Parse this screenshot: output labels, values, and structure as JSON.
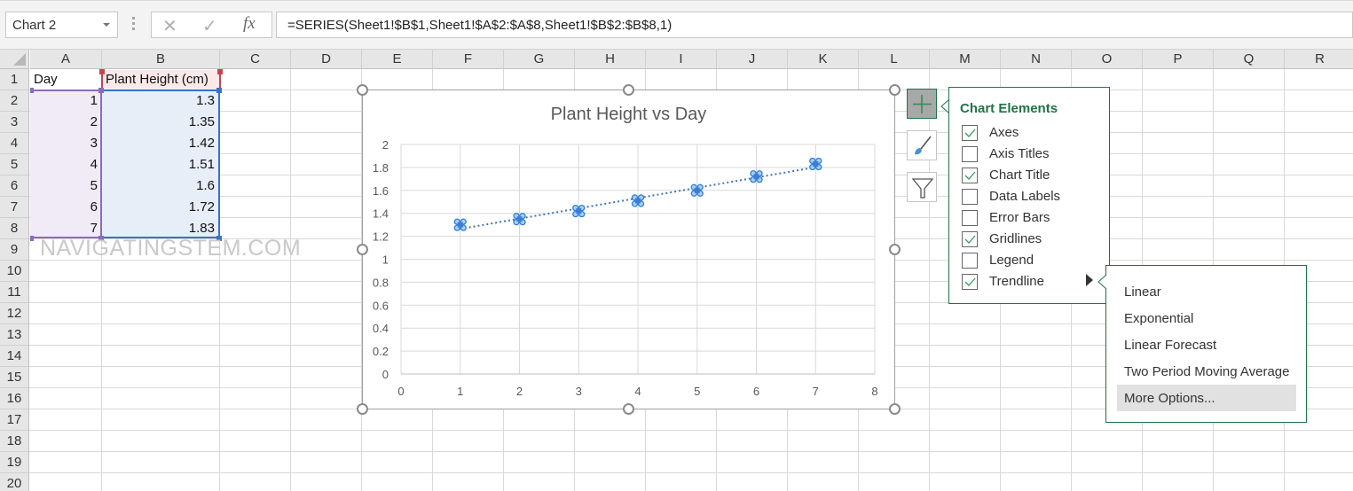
{
  "formula_bar": {
    "name_box": "Chart 2",
    "cancel_icon": "x-icon",
    "enter_icon": "check-icon",
    "fx_label": "fx",
    "formula": "=SERIES(Sheet1!$B$1,Sheet1!$A$2:$A$8,Sheet1!$B$2:$B$8,1)"
  },
  "columns": [
    "A",
    "B",
    "C",
    "D",
    "E",
    "F",
    "G",
    "H",
    "I",
    "J",
    "K",
    "L",
    "M",
    "N",
    "O",
    "P",
    "Q",
    "R"
  ],
  "rows": [
    "1",
    "2",
    "3",
    "4",
    "5",
    "6",
    "7",
    "8",
    "9",
    "10",
    "11",
    "12",
    "13",
    "14",
    "15",
    "16",
    "17",
    "18",
    "19",
    "20"
  ],
  "sheet": {
    "header": {
      "A": "Day",
      "B": "Plant Height (cm)"
    },
    "data": [
      {
        "A": "1",
        "B": "1.3"
      },
      {
        "A": "2",
        "B": "1.35"
      },
      {
        "A": "3",
        "B": "1.42"
      },
      {
        "A": "4",
        "B": "1.51"
      },
      {
        "A": "5",
        "B": "1.6"
      },
      {
        "A": "6",
        "B": "1.72"
      },
      {
        "A": "7",
        "B": "1.83"
      }
    ]
  },
  "watermark": "NAVIGATINGSTEM.COM",
  "chart_data": {
    "type": "scatter",
    "title": "Plant Height vs Day",
    "xlabel": "",
    "ylabel": "",
    "x": [
      1,
      2,
      3,
      4,
      5,
      6,
      7
    ],
    "series": [
      {
        "name": "Plant Height (cm)",
        "values": [
          1.3,
          1.35,
          1.42,
          1.51,
          1.6,
          1.72,
          1.83
        ]
      }
    ],
    "xlim": [
      0,
      8
    ],
    "ylim": [
      0,
      2
    ],
    "x_ticks": [
      "0",
      "1",
      "2",
      "3",
      "4",
      "5",
      "6",
      "7",
      "8"
    ],
    "y_ticks": [
      "0",
      "0.2",
      "0.4",
      "0.6",
      "0.8",
      "1",
      "1.2",
      "1.4",
      "1.6",
      "1.8",
      "2"
    ],
    "grid": true,
    "legend": "none",
    "trendline": "linear",
    "colors": {
      "marker": "#4a90d9",
      "trendline": "#4472c4",
      "grid": "#d9d9d9"
    }
  },
  "chart_buttons": {
    "elements": "plus-icon",
    "styles": "paintbrush-icon",
    "filters": "funnel-icon"
  },
  "chart_elements_panel": {
    "title": "Chart Elements",
    "items": [
      {
        "label": "Axes",
        "checked": true
      },
      {
        "label": "Axis Titles",
        "checked": false
      },
      {
        "label": "Chart Title",
        "checked": true
      },
      {
        "label": "Data Labels",
        "checked": false
      },
      {
        "label": "Error Bars",
        "checked": false
      },
      {
        "label": "Gridlines",
        "checked": true
      },
      {
        "label": "Legend",
        "checked": false
      },
      {
        "label": "Trendline",
        "checked": true
      }
    ]
  },
  "trendline_submenu": {
    "items": [
      "Linear",
      "Exponential",
      "Linear Forecast",
      "Two Period Moving Average",
      "More Options..."
    ],
    "highlighted": "More Options..."
  },
  "accent_color": "#217346"
}
